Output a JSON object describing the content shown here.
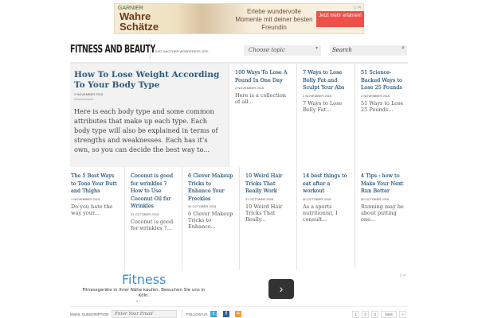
{
  "ad_top": {
    "brand": "GARNIER",
    "product": "Wahre Schätze",
    "message": "Erlebe wundervolle Momente mit deiner besten Freundin",
    "cta": "Jetzt mehr erfahren!",
    "close": "▷✕"
  },
  "header": {
    "logo": "FITNESS AND BEAUTY",
    "tagline": "JUST ANOTHER WORDPRESS SITE",
    "topic_select": "Choose topic",
    "search_placeholder": "Search"
  },
  "featured": {
    "title": "How To Lose Weight According To Your Body Type",
    "date": "2 NOVEMBER 2015",
    "excerpt": "Here is each body type and some common attributes that make up each type. Each body type will also be explained in terms of strengths and weaknesses. Each has it’s own, so you can decide the best way to..."
  },
  "posts_row1": [
    {
      "title": "100 Ways To Lose A Pound In One Day",
      "date": "2 NOVEMBER 2015",
      "excerpt": "Here is a collection of all..."
    },
    {
      "title": "7 Ways to Lose Belly Fat and Sculpt Your Abs",
      "date": "2 NOVEMBER 2015",
      "excerpt": "7 Ways to Lose Belly Fat..."
    },
    {
      "title": "51 Science-Backed Ways to Lose 25 Pounds",
      "date": "2 NOVEMBER 2015",
      "excerpt": "51 Ways to Lose 25 Pounds..."
    }
  ],
  "posts_row2": [
    {
      "title": "The 5 Best Ways to Tone Your Butt and Thighs",
      "date": "1 NOVEMBER 2015",
      "excerpt": "Do you hate the way your..."
    },
    {
      "title": "Coconut is good for wrinkles ? How to Use Coconut Oil for Wrinkles",
      "date": "31 OCTOBER 2015",
      "excerpt": "Coconut is good for wrinkles ?..."
    },
    {
      "title": "6 Clever Makeup Tricks to Enhance Your Freckles",
      "date": "31 OCTOBER 2015",
      "excerpt": "6 Clever Makeup Tricks to Enhance..."
    },
    {
      "title": "10 Weird Hair Tricks That Really Work",
      "date": "31 OCTOBER 2015",
      "excerpt": "10 Weird Hair Tricks That Really..."
    },
    {
      "title": "14 best things to eat after a workout",
      "date": "30 OCTOBER 2015",
      "excerpt": "As a sports nutritionist, I consult..."
    },
    {
      "title": "4 Tips : how to Make Your Next Run Better",
      "date": "30 OCTOBER 2015",
      "excerpt": "Running may be about putting one..."
    }
  ],
  "ad_bottom": {
    "title": "Fitness",
    "description": "Fitnessgeräte in Ihrer Nähe kaufen. Besuchen Sie uns in Köln.",
    "dots": "● ○",
    "next": "›",
    "close": "▷✕"
  },
  "footer": {
    "email_label": "EMAIL SUBSCRIPTION",
    "email_placeholder": "Enter Your Email",
    "follow_label": "FOLLOW US",
    "pages": [
      "1",
      "2",
      "3"
    ],
    "next": "Next",
    "last": "»"
  }
}
